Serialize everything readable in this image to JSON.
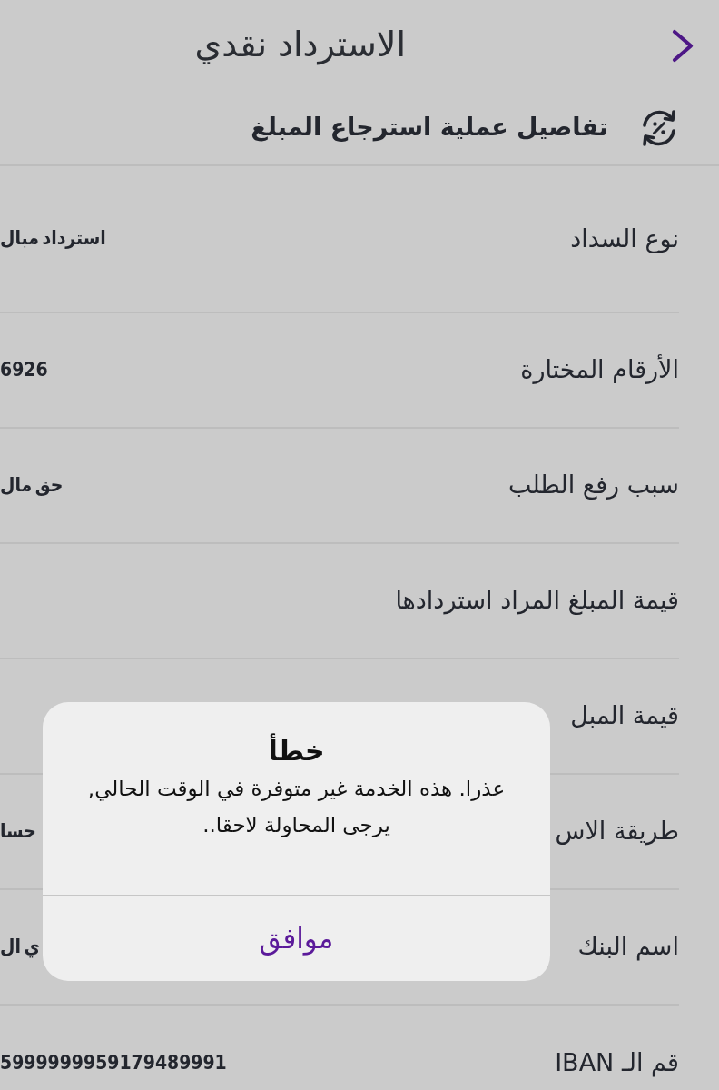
{
  "header": {
    "title": "الاسترداد نقدي"
  },
  "section": {
    "title": "تفاصيل عملية استرجاع المبلغ"
  },
  "rows": [
    {
      "label": "نوع السداد",
      "value": "استرداد مبال"
    },
    {
      "label": "الأرقام المختارة",
      "value": "6926"
    },
    {
      "label": "سبب رفع الطلب",
      "value": "حق مال"
    },
    {
      "label": "قيمة المبلغ المراد استردادها"
    },
    {
      "label": "قيمة المبل"
    },
    {
      "label": "طريقة الاس",
      "value": "حسا"
    },
    {
      "label": "اسم البنك",
      "value": "ي ال"
    },
    {
      "label": "قم الـ IBAN",
      "value": "5999999959179489991"
    }
  ],
  "alert": {
    "title": "خطأ",
    "message": "عذرا. هذه الخدمة غير متوفرة في الوقت الحالي, يرجى المحاولة لاحقا..",
    "buttons": [
      "موافق"
    ]
  }
}
